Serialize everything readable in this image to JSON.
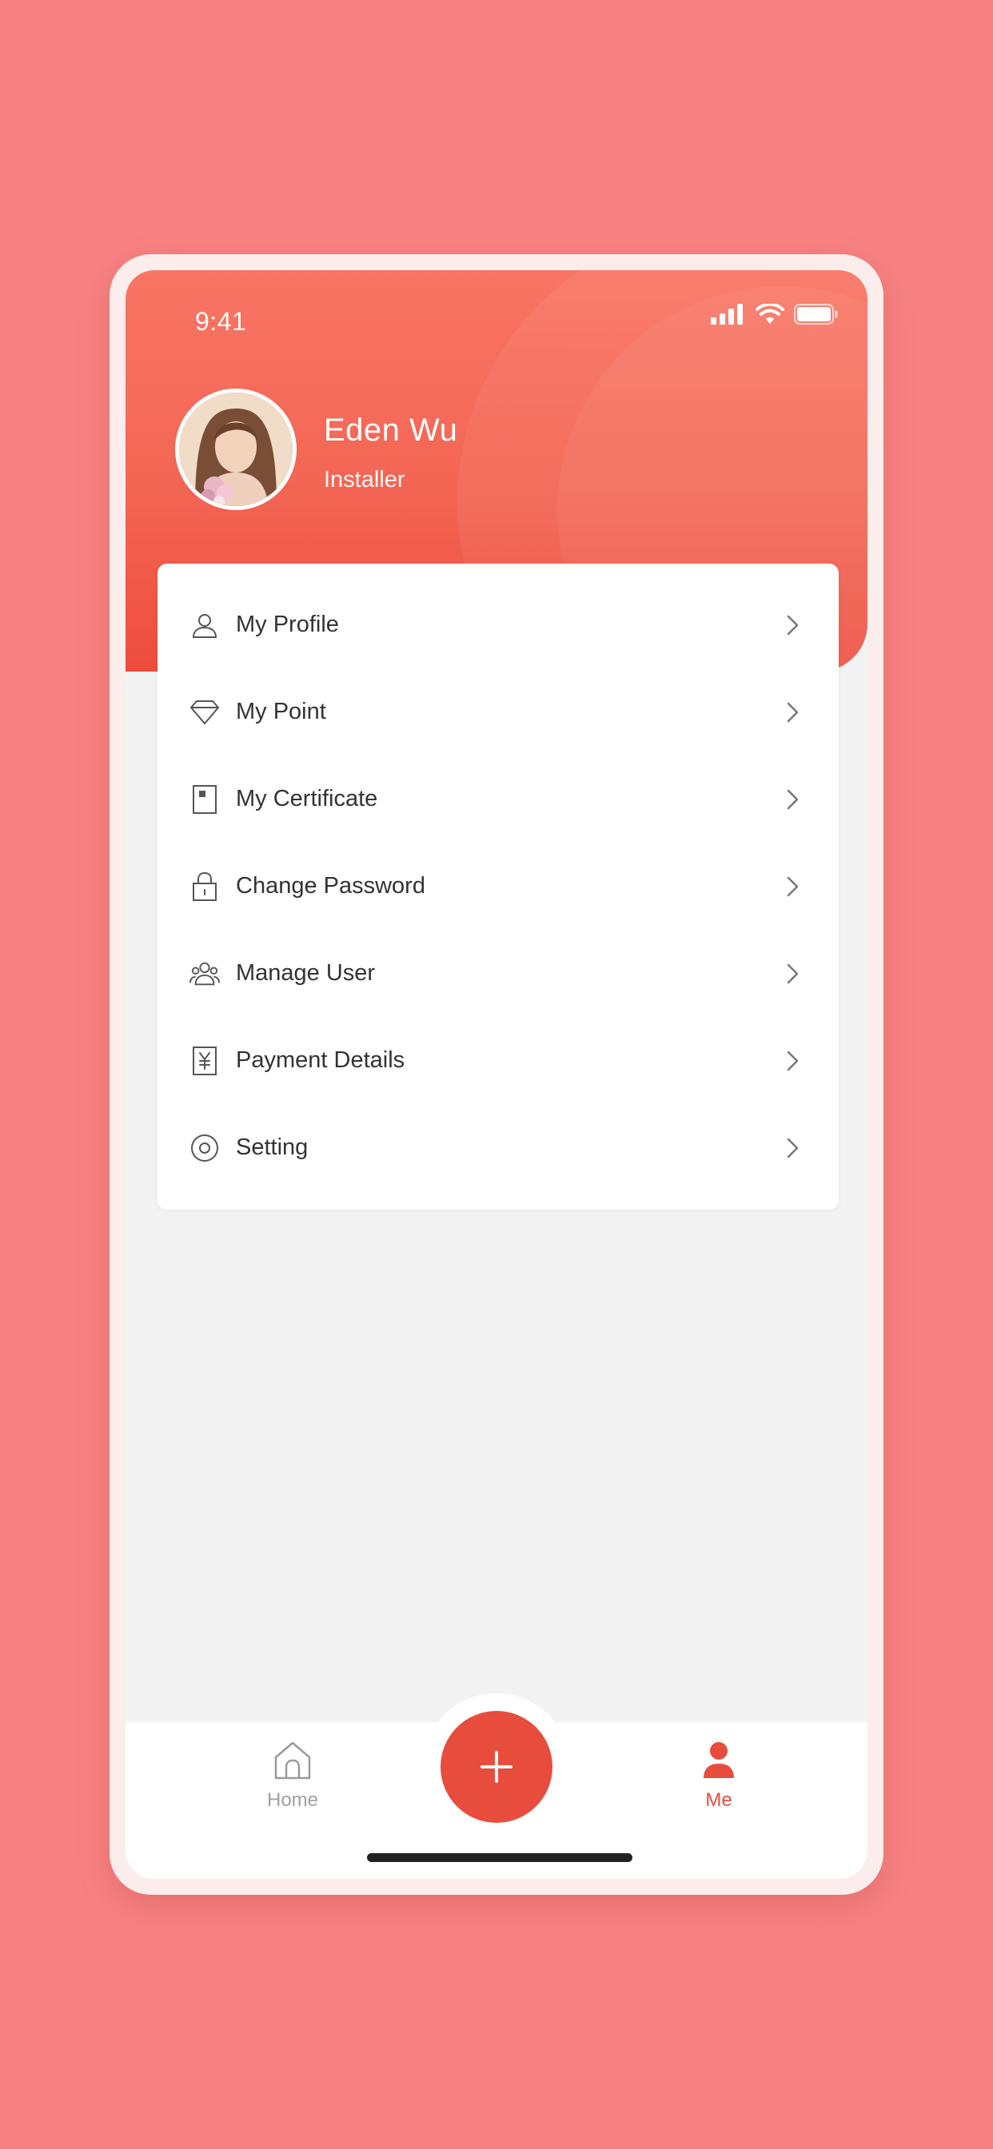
{
  "status_bar": {
    "time": "9:41"
  },
  "profile": {
    "name": "Eden Wu",
    "role": "Installer"
  },
  "menu": {
    "items": [
      {
        "label": "My Profile",
        "icon": "user-icon"
      },
      {
        "label": "My Point",
        "icon": "diamond-icon"
      },
      {
        "label": "My Certificate",
        "icon": "certificate-icon"
      },
      {
        "label": "Change Password",
        "icon": "lock-icon"
      },
      {
        "label": "Manage User",
        "icon": "users-icon"
      },
      {
        "label": "Payment Details",
        "icon": "yen-document-icon"
      },
      {
        "label": "Setting",
        "icon": "settings-icon"
      }
    ]
  },
  "tabbar": {
    "home_label": "Home",
    "me_label": "Me",
    "active_tab": "Me"
  },
  "colors": {
    "background": "#F78181",
    "accent": "#E84C3D",
    "header_top": "#F97564",
    "header_bottom": "#EE4D3E",
    "inactive_tab": "#A0A0A0"
  }
}
